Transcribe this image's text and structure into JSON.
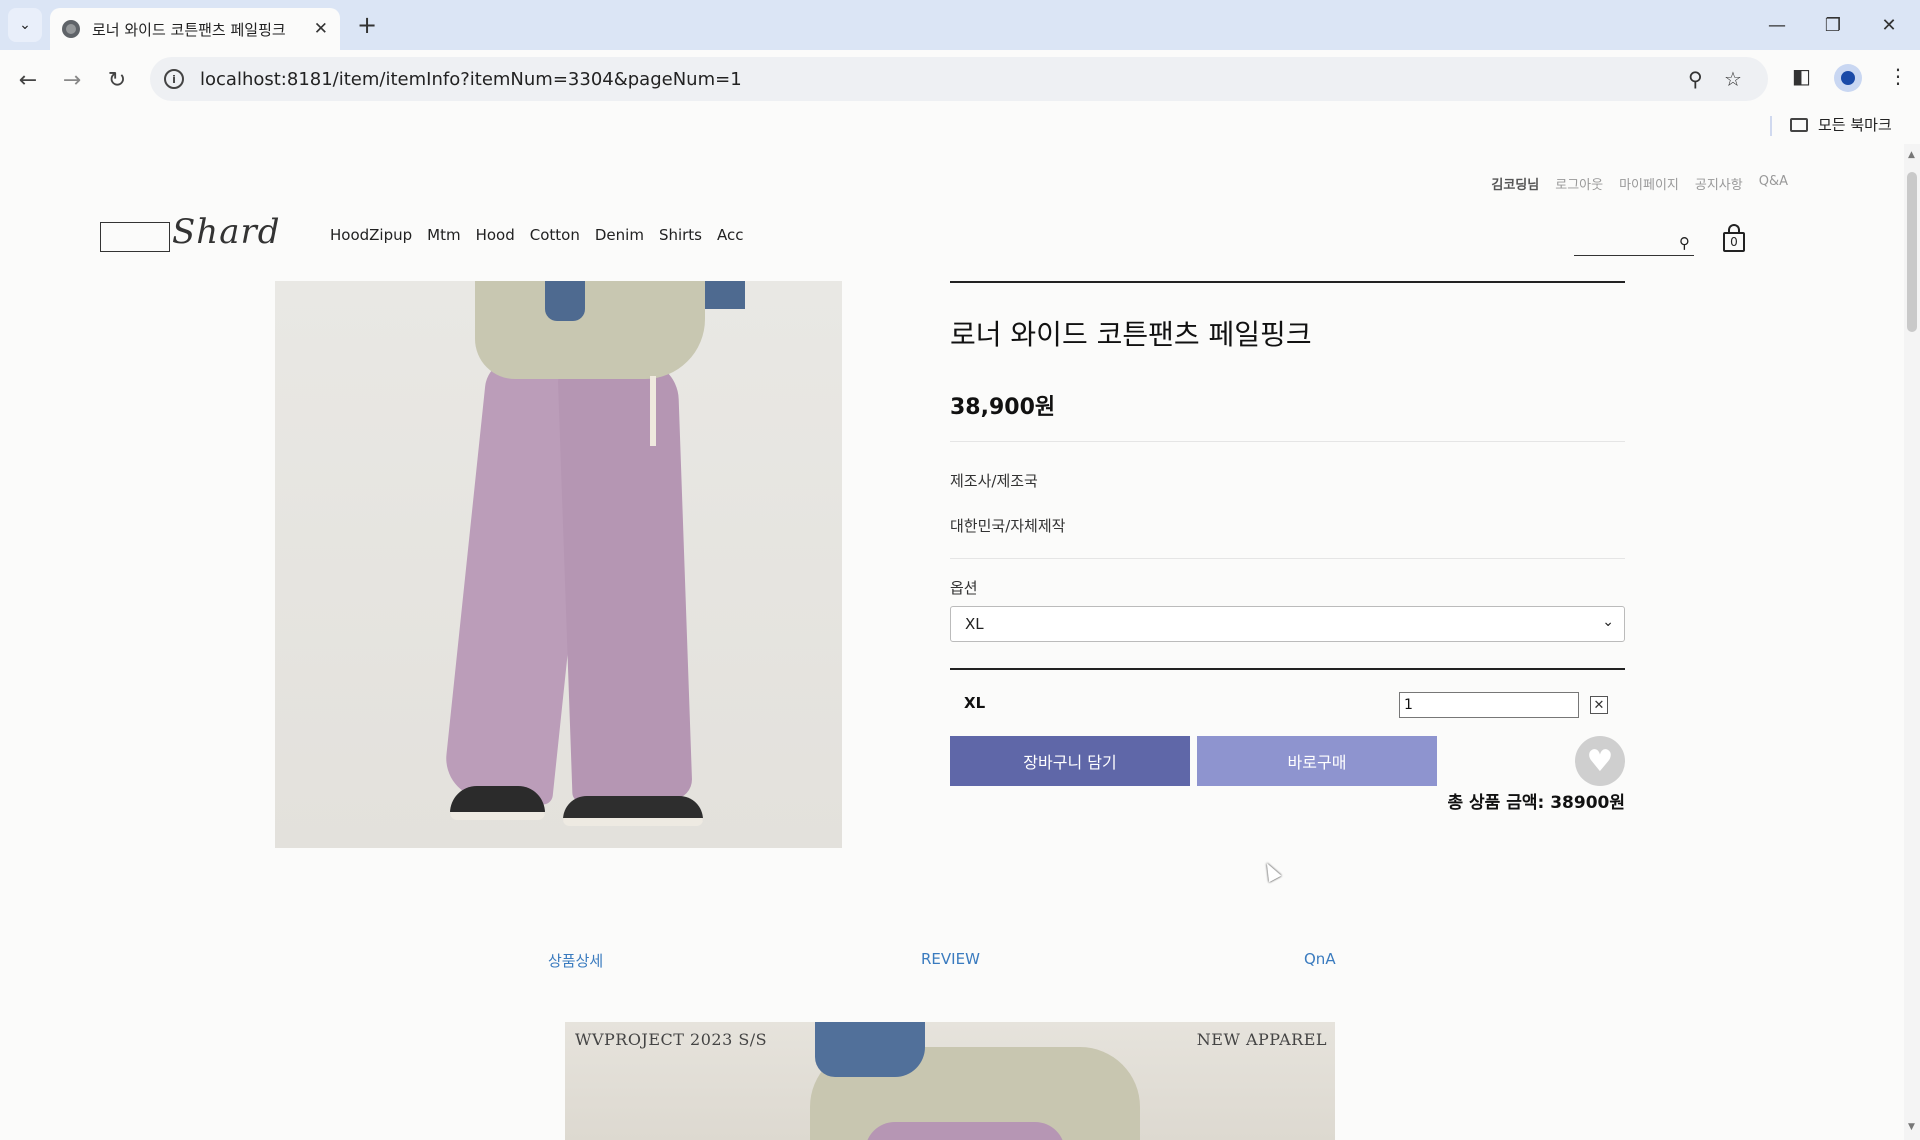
{
  "browser": {
    "tab_title": "로너 와이드 코튼팬츠 페일핑크",
    "url": "localhost:8181/item/itemInfo?itemNum=3304&pageNum=1",
    "bookmarks_label": "모든 북마크"
  },
  "site": {
    "logo_text": "Shard",
    "util_menu": [
      "김코딩님",
      "로그아웃",
      "마이페이지",
      "공지사항",
      "Q&A"
    ],
    "nav": [
      "HoodZipup",
      "Mtm",
      "Hood",
      "Cotton",
      "Denim",
      "Shirts",
      "Acc"
    ],
    "cart_count": "0"
  },
  "product": {
    "name": "로너 와이드 코튼팬츠 페일핑크",
    "price": "38,900원",
    "manufacturer_label": "제조사/제조국",
    "manufacturer_value": "대한민국/자체제작",
    "option_label": "옵션",
    "selected_option": "XL",
    "quantity": "1",
    "add_to_cart": "장바구니 담기",
    "buy_now": "바로구매",
    "total": "총 상품 금액: 38900원"
  },
  "tabs": [
    "상품상세",
    "REVIEW",
    "QnA"
  ],
  "banner": {
    "left_text": "WVPROJECT 2023 S/S",
    "right_text": "NEW APPAREL"
  },
  "icons": {
    "tab_favicon": "globe-icon",
    "wishlist": "heart-icon",
    "cart": "shopping-bag-icon",
    "search": "search-icon"
  },
  "colors": {
    "cart_button": "#5f67a8",
    "buy_button": "#8e94cf",
    "tab_link": "#3a7bbf"
  }
}
